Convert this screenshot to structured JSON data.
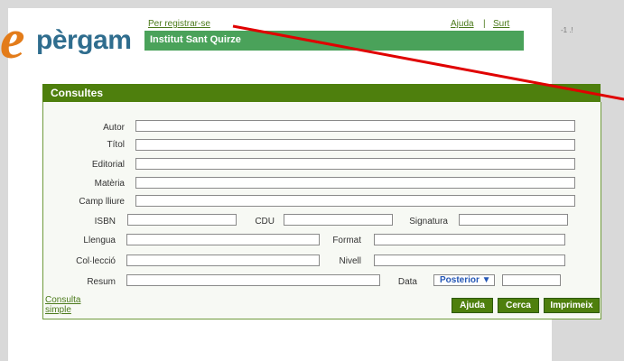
{
  "top": {
    "register_link": "Per registrar-se",
    "help_link": "Ajuda",
    "separator": "|",
    "logout_link": "Surt",
    "institution": "Institut Sant Quirze",
    "corner_text": "-1 .!"
  },
  "logo": {
    "e": "e",
    "text": "pèrgam"
  },
  "panel": {
    "title": "Consultes",
    "fields": {
      "autor": "Autor",
      "titol": "Títol",
      "editorial": "Editorial",
      "materia": "Matèria",
      "camp": "Camp lliure",
      "isbn": "ISBN",
      "cdu": "CDU",
      "signatura": "Signatura",
      "llengua": "Llengua",
      "format": "Format",
      "colleccio": "Col·lecció",
      "nivell": "Nivell",
      "resum": "Resum",
      "data": "Data"
    },
    "date_select": "Posterior ▼",
    "simple_link": "Consulta simple",
    "buttons": {
      "help": "Ajuda",
      "search": "Cerca",
      "print": "Imprimeix"
    }
  },
  "colors": {
    "accent_green": "#4e7f0d",
    "banner_green": "#4aa25a",
    "logo_orange": "#e37c1a",
    "logo_blue": "#2f6d8e",
    "arrow_red": "#e00000"
  }
}
